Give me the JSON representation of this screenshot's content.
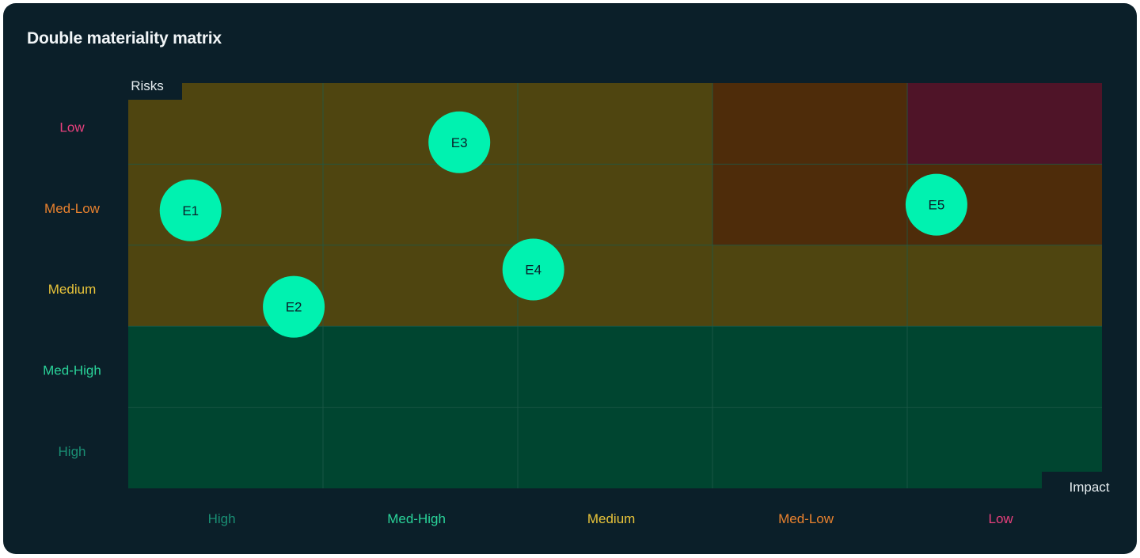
{
  "title": "Double materiality matrix",
  "chart_data": {
    "type": "scatter",
    "title": "Double materiality matrix",
    "xlabel": "Impact",
    "ylabel": "Risks",
    "x_categories": [
      "High",
      "Med-High",
      "Medium",
      "Med-Low",
      "Low"
    ],
    "y_categories": [
      "High",
      "Med-High",
      "Medium",
      "Med-Low",
      "Low"
    ],
    "category_colors": {
      "High": "#1a8f74",
      "Med-High": "#2ad399",
      "Medium": "#e8c33a",
      "Med-Low": "#e8812e",
      "Low": "#e8407d"
    },
    "cell_colors": {
      "green": "#004530",
      "yellow": "#4f4510",
      "orange": "#4e2c0a",
      "red": "#4f1428",
      "grid_line": "#1e5a48"
    },
    "grid": true,
    "points": [
      {
        "label": "E1",
        "x": 0.32,
        "y": 3.43
      },
      {
        "label": "E2",
        "x": 0.85,
        "y": 2.24
      },
      {
        "label": "E3",
        "x": 1.7,
        "y": 4.27
      },
      {
        "label": "E4",
        "x": 2.08,
        "y": 2.7
      },
      {
        "label": "E5",
        "x": 4.15,
        "y": 3.5
      }
    ],
    "point_color": "#00f2b0",
    "point_text_color": "#0b1f29"
  }
}
